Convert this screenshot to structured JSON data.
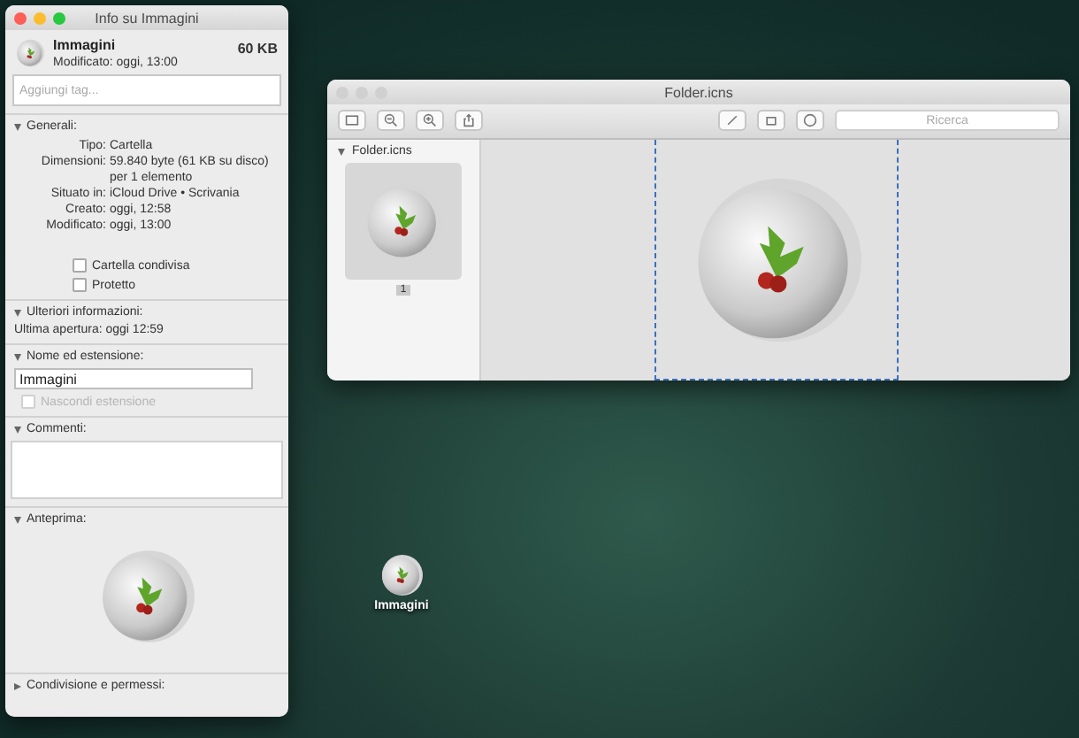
{
  "info_window": {
    "title": "Info su Immagini",
    "name": "Immagini",
    "size": "60 KB",
    "modified": "Modificato: oggi, 13:00",
    "tags_placeholder": "Aggiungi tag...",
    "sections": [
      {
        "kind": "details",
        "title": "Generali:",
        "expanded": true,
        "rows": [
          {
            "label": "Tipo:",
            "value": "Cartella"
          },
          {
            "label": "Dimensioni:",
            "value": "59.840 byte (61 KB su disco) per 1 elemento"
          },
          {
            "label": "Situato in:",
            "value": "iCloud Drive • Scrivania"
          },
          {
            "label": "Creato:",
            "value": "oggi, 12:58"
          },
          {
            "label": "Modificato:",
            "value": "oggi, 13:00"
          }
        ],
        "checkboxes": [
          {
            "label": "Cartella condivisa",
            "checked": false,
            "disabled": false
          },
          {
            "label": "Protetto",
            "checked": false,
            "disabled": false
          }
        ]
      },
      {
        "kind": "text",
        "title": "Ulteriori informazioni:",
        "expanded": true,
        "text": "Ultima apertura: oggi 12:59"
      },
      {
        "kind": "name",
        "title": "Nome ed estensione:",
        "expanded": true,
        "value": "Immagini",
        "checkboxes": [
          {
            "label": "Nascondi estensione",
            "checked": false,
            "disabled": true
          }
        ]
      },
      {
        "kind": "comments",
        "title": "Commenti:",
        "expanded": true
      },
      {
        "kind": "preview",
        "title": "Anteprima:",
        "expanded": true
      },
      {
        "title": "Condivisione e permessi:",
        "expanded": false
      }
    ]
  },
  "preview_window": {
    "title": "Folder.icns",
    "search_placeholder": "Ricerca",
    "sidebar": {
      "file": "Folder.icns",
      "expanded": true,
      "pages": [
        {
          "label": "1",
          "selected": true
        }
      ]
    }
  },
  "desktop_icon": {
    "label": "Immagini"
  }
}
